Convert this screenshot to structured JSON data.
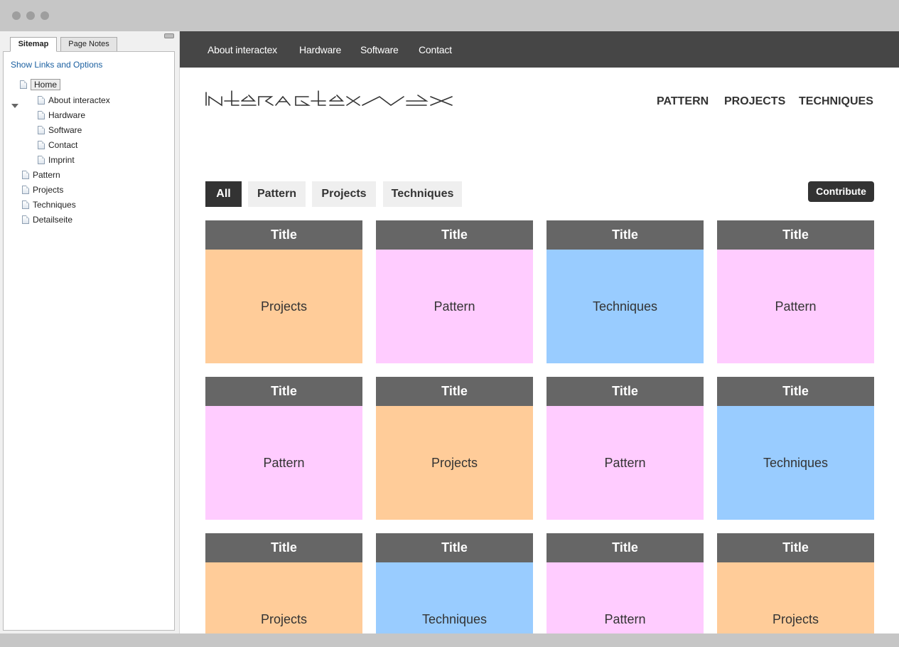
{
  "sitemap": {
    "tabs": [
      "Sitemap",
      "Page Notes"
    ],
    "show_links": "Show Links and Options",
    "tree": {
      "home": "Home",
      "children": [
        "About interactex",
        "Hardware",
        "Software",
        "Contact",
        "Imprint"
      ],
      "top_level": [
        "Pattern",
        "Projects",
        "Techniques",
        "Detailseite"
      ]
    }
  },
  "site": {
    "topnav": [
      "About interactex",
      "Hardware",
      "Software",
      "Contact"
    ],
    "main_nav": [
      "PATTERN",
      "PROJECTS",
      "TECHNIQUES"
    ],
    "filters": [
      "All",
      "Pattern",
      "Projects",
      "Techniques"
    ],
    "contribute": "Contribute",
    "colors": {
      "Projects": "#ffcc99",
      "Pattern": "#ffccff",
      "Techniques": "#99ccff",
      "card_header": "#666666",
      "topnav": "#464646"
    },
    "cards": [
      {
        "title": "Title",
        "category": "Projects"
      },
      {
        "title": "Title",
        "category": "Pattern"
      },
      {
        "title": "Title",
        "category": "Techniques"
      },
      {
        "title": "Title",
        "category": "Pattern"
      },
      {
        "title": "Title",
        "category": "Pattern"
      },
      {
        "title": "Title",
        "category": "Projects"
      },
      {
        "title": "Title",
        "category": "Pattern"
      },
      {
        "title": "Title",
        "category": "Techniques"
      },
      {
        "title": "Title",
        "category": "Projects"
      },
      {
        "title": "Title",
        "category": "Techniques"
      },
      {
        "title": "Title",
        "category": "Pattern"
      },
      {
        "title": "Title",
        "category": "Projects"
      }
    ]
  }
}
